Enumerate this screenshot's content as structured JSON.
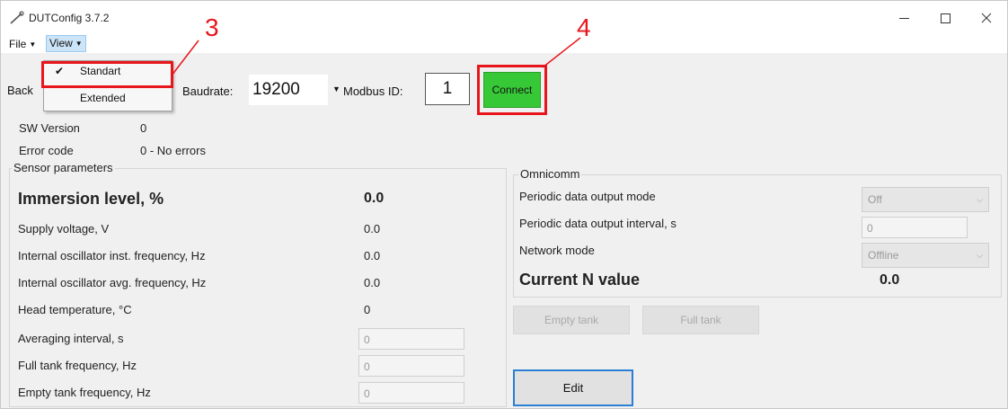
{
  "window": {
    "title": "DUTConfig 3.7.2"
  },
  "menu": {
    "file": "File",
    "view": "View"
  },
  "view_menu": {
    "items": [
      "Standart",
      "Extended"
    ],
    "checked_index": 0
  },
  "toolbar": {
    "back_label": "Back",
    "baudrate_label": "Baudrate:",
    "baudrate_value": "19200",
    "modbus_label": "Modbus ID:",
    "modbus_value": "1",
    "connect_label": "Connect"
  },
  "info": {
    "sw_version_label": "SW Version",
    "sw_version_value": "0",
    "error_code_label": "Error code",
    "error_code_value": "0 - No errors"
  },
  "sensor": {
    "title": "Sensor parameters",
    "rows": [
      {
        "label": "Immersion level, %",
        "value": "0.0"
      },
      {
        "label": "Supply voltage, V",
        "value": "0.0"
      },
      {
        "label": "Internal oscillator inst. frequency, Hz",
        "value": "0.0"
      },
      {
        "label": "Internal oscillator avg. frequency, Hz",
        "value": "0.0"
      },
      {
        "label": "Head temperature, °C",
        "value": "0"
      },
      {
        "label": "Averaging interval, s",
        "value": "0"
      },
      {
        "label": "Full tank frequency, Hz",
        "value": "0"
      },
      {
        "label": "Empty tank frequency, Hz",
        "value": "0"
      }
    ]
  },
  "omnicomm": {
    "title": "Omnicomm",
    "periodic_mode_label": "Periodic data output mode",
    "periodic_mode_value": "Off",
    "periodic_interval_label": "Periodic data output interval, s",
    "periodic_interval_value": "0",
    "network_mode_label": "Network mode",
    "network_mode_value": "Offline",
    "current_n_label": "Current N value",
    "current_n_value": "0.0"
  },
  "buttons": {
    "empty_tank": "Empty tank",
    "full_tank": "Full tank",
    "edit": "Edit"
  },
  "annotations": {
    "marker_3": "3",
    "marker_4": "4"
  },
  "colors": {
    "connect_bg": "#37c837",
    "annotation": "#e8161c",
    "edit_focus": "#2b7fd4"
  }
}
